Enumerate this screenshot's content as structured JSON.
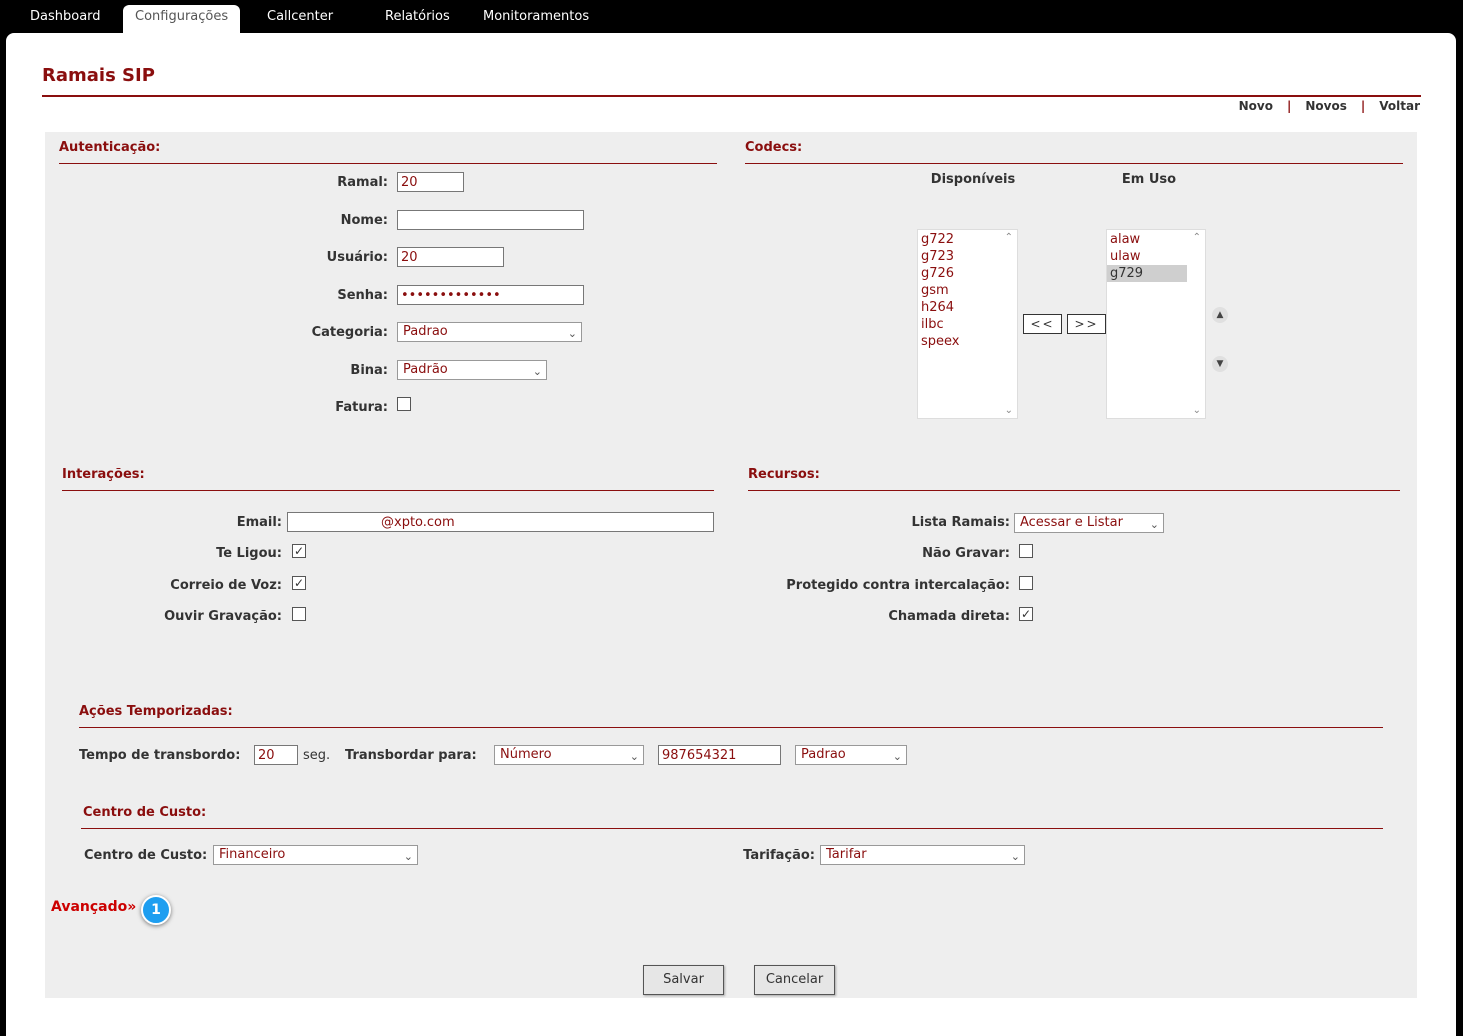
{
  "nav": {
    "tabs": [
      {
        "label": "Dashboard"
      },
      {
        "label": "Configurações"
      },
      {
        "label": "Callcenter"
      },
      {
        "label": "Relatórios"
      },
      {
        "label": "Monitoramentos"
      }
    ],
    "active": "Configurações"
  },
  "page": {
    "title": "Ramais SIP",
    "links": {
      "novo": "Novo",
      "novos": "Novos",
      "voltar": "Voltar",
      "sep": "|"
    }
  },
  "autenticacao": {
    "title": "Autenticação:",
    "ramal_label": "Ramal:",
    "ramal_value": "20",
    "nome_label": "Nome:",
    "nome_value": "",
    "usuario_label": "Usuário:",
    "usuario_value": "20",
    "senha_label": "Senha:",
    "senha_value": "•••••••••••••",
    "categoria_label": "Categoria:",
    "categoria_value": "Padrao",
    "bina_label": "Bina:",
    "bina_value": "Padrão",
    "fatura_label": "Fatura:",
    "fatura_checked": false
  },
  "codecs": {
    "title": "Codecs:",
    "available_label": "Disponíveis",
    "inuse_label": "Em Uso",
    "available": [
      "g722",
      "g723",
      "g726",
      "gsm",
      "h264",
      "ilbc",
      "speex"
    ],
    "inuse": [
      "alaw",
      "ulaw",
      "g729"
    ],
    "selected": "g729",
    "move_left": "<<",
    "move_right": ">>"
  },
  "interacoes": {
    "title": "Interações:",
    "email_label": "Email:",
    "email_value": "@xpto.com",
    "te_ligou_label": "Te Ligou:",
    "te_ligou": true,
    "correio_label": "Correio de Voz:",
    "correio": true,
    "ouvir_label": "Ouvir Gravação:",
    "ouvir": false
  },
  "recursos": {
    "title": "Recursos:",
    "lista_label": "Lista Ramais:",
    "lista_value": "Acessar e Listar",
    "nao_gravar_label": "Não Gravar:",
    "nao_gravar": false,
    "protegido_label": "Protegido contra intercalação:",
    "protegido": false,
    "chamada_label": "Chamada direta:",
    "chamada": true
  },
  "acoes": {
    "title": "Ações Temporizadas:",
    "tempo_label": "Tempo de transbordo:",
    "tempo_value": "20",
    "unit": "seg.",
    "transbordar_label": "Transbordar para:",
    "tipo_value": "Número",
    "numero_value": "987654321",
    "padrao_value": "Padrao"
  },
  "centro": {
    "title": "Centro de Custo:",
    "centro_label": "Centro de Custo:",
    "centro_value": "Financeiro",
    "tarifacao_label": "Tarifação:",
    "tarifacao_value": "Tarifar"
  },
  "footer": {
    "avancado": "Avançado»",
    "badge": "1",
    "salvar": "Salvar",
    "cancelar": "Cancelar"
  },
  "colors": {
    "accent": "#8a0e0e",
    "badge": "#1e9ef0",
    "form_bg": "#eeeeee"
  }
}
